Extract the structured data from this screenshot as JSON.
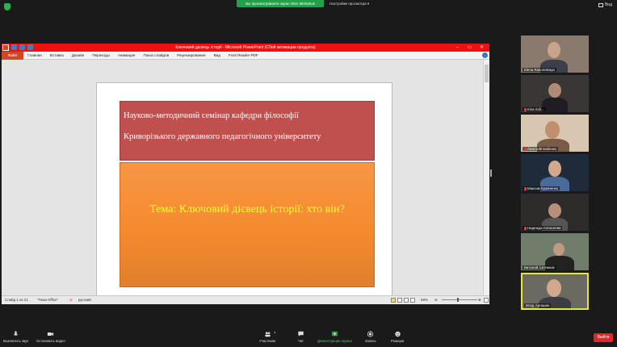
{
  "top_bar": {
    "share_notice": "Вы просматриваете экран Olen Mishahuk",
    "view_options": "Настройки просмотра",
    "view_label": "Вид"
  },
  "ppt": {
    "title": "Ключовий дієвець історії - Microsoft PowerPoint (Сбой активации продукта)",
    "tabs": [
      "Файл",
      "Главная",
      "Вставка",
      "Дизайн",
      "Переходы",
      "Анимация",
      "Показ слайдов",
      "Рецензирование",
      "Вид",
      "Foxit Reader PDF"
    ],
    "slide": {
      "header_line1": "Науково-методичний семінар кафедри філософії",
      "header_line2": "Криворізького державного педагогічного університету",
      "topic": "Тема: Ключовий дієвець історії: хто він?"
    },
    "status": {
      "slide_counter": "Слайд 1 из 21",
      "theme": "\"Тема Office\"",
      "language": "русский",
      "zoom": "68%"
    }
  },
  "participants": [
    {
      "name": "Elena Rasomskaya"
    },
    {
      "name": "Irina Sch..."
    },
    {
      "name": "Анатолій Бабенко"
    },
    {
      "name": "Максим Кравченко"
    },
    {
      "name": "Надежда Алексеева"
    },
    {
      "name": "Виталий Ситников"
    },
    {
      "name": "Влад Аргашин"
    }
  ],
  "toolbar": {
    "mute": "Выключить звук",
    "video": "Остановить видео",
    "participants": "Участники",
    "participants_count": "7",
    "chat": "Чат",
    "share": "Демонстрация экрана",
    "record": "Запись",
    "reactions": "Реакции",
    "end": "Выйти"
  },
  "colors": {
    "ppt_titlebar": "#ee1111",
    "slide_header": "#c0504d",
    "slide_body": "#f79646",
    "topic_text": "#ffff33",
    "zoom_green": "#25a04a",
    "end_red": "#e02828"
  }
}
